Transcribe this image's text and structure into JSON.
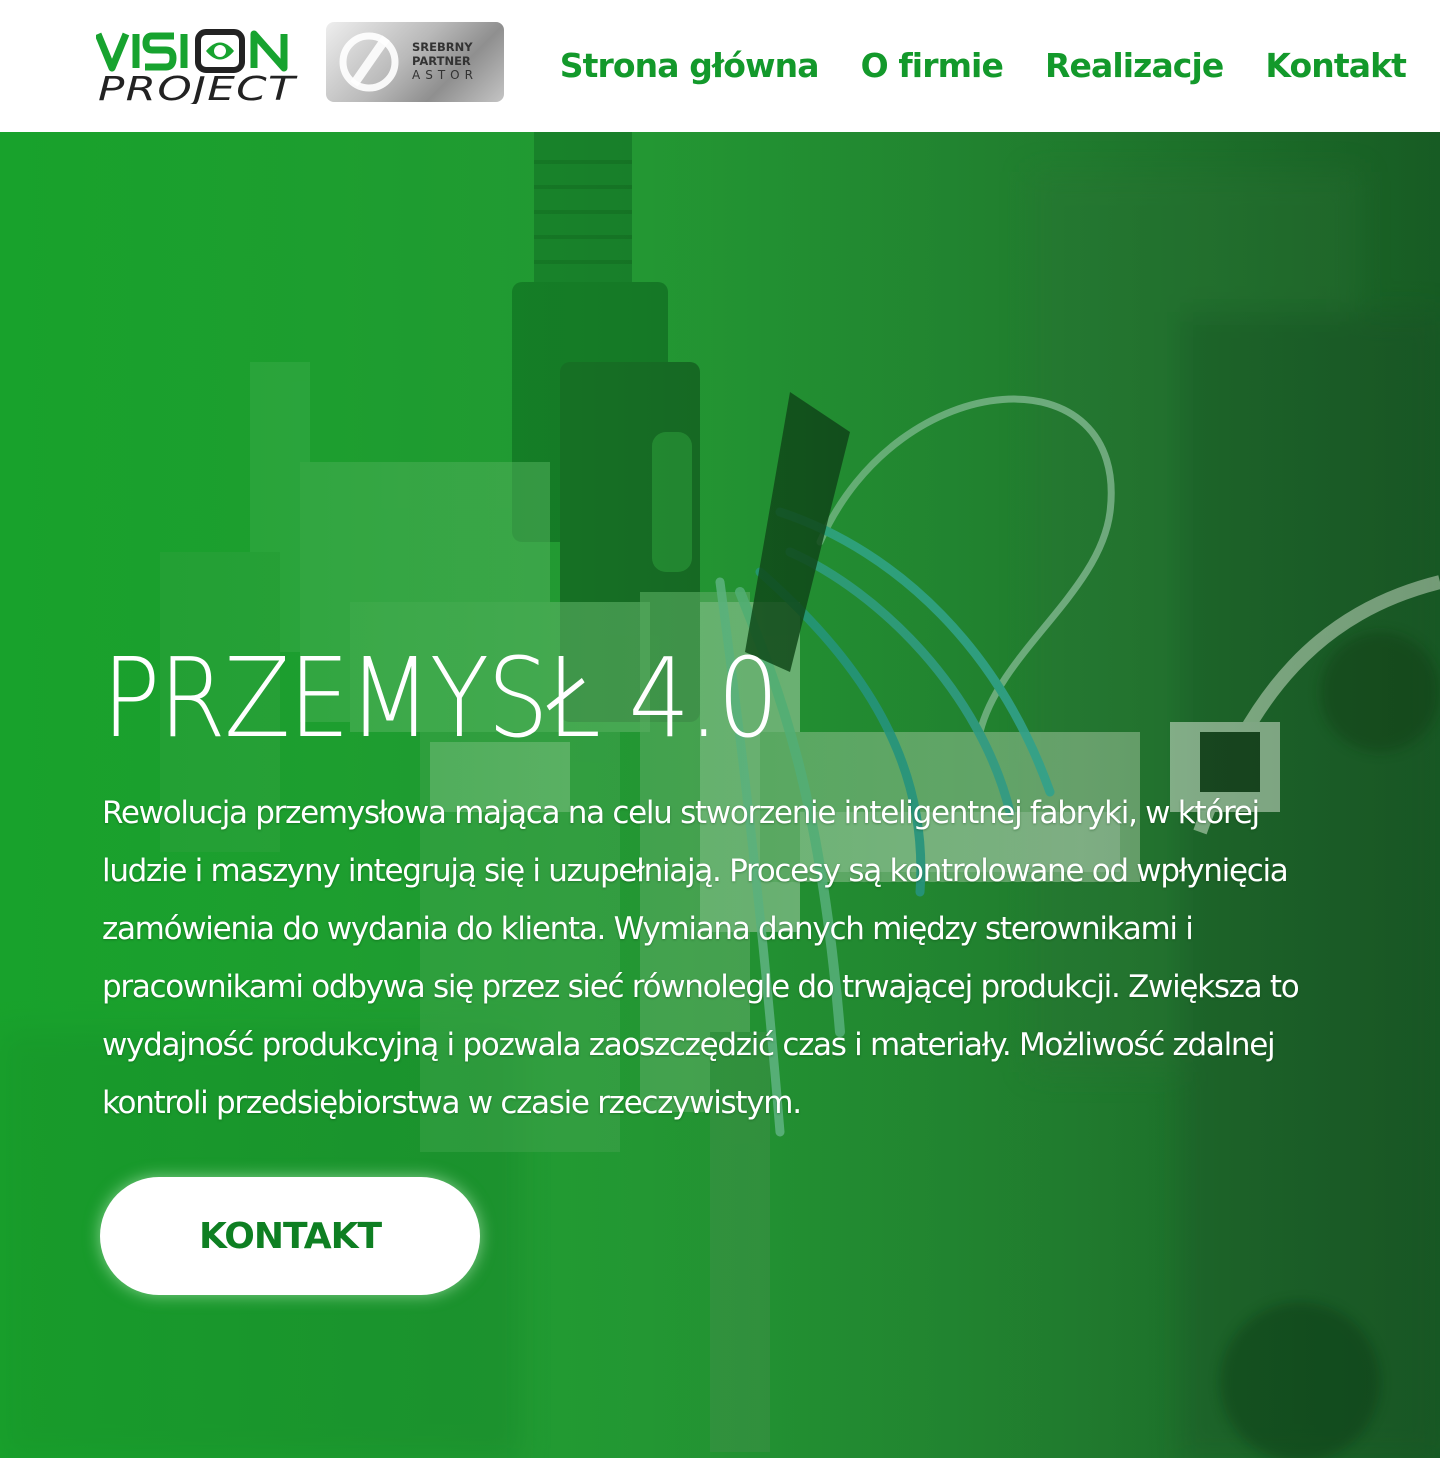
{
  "header": {
    "logo": {
      "text_top": "VISION",
      "text_bottom": "PROJECT"
    },
    "partner_badge": {
      "line1": "SREBRNY",
      "line2": "PARTNER",
      "line3": "ASTOR"
    },
    "nav": [
      {
        "label": "Strona główna"
      },
      {
        "label": "O firmie"
      },
      {
        "label": "Realizacje"
      },
      {
        "label": "Kontakt"
      }
    ]
  },
  "hero": {
    "title": "PRZEMYSŁ 4.0",
    "text": "Rewolucja przemysłowa mająca na celu stworzenie inteligentnej fabryki, w której ludzie i maszyny integrują się i uzupełniają. Procesy są kontrolowane od wpłynięcia zamówienia do wydania do klienta. Wymiana danych między sterownikami i pracownikami odbywa się przez sieć równolegle do trwającej produkcji. Zwiększa to wydajność produkcyjną i pozwala zaoszczędzić czas i materiały. Możliwość zdalnej kontroli przedsiębiorstwa w czasie rzeczywistym.",
    "button_label": "KONTAKT"
  },
  "colors": {
    "brand_green": "#13992b",
    "hero_green": "#1e8e30",
    "button_text": "#0e7f22",
    "white": "#ffffff"
  },
  "icons": {
    "logo_eye": "eye-icon",
    "partner_mark": "slash-circle-icon"
  }
}
